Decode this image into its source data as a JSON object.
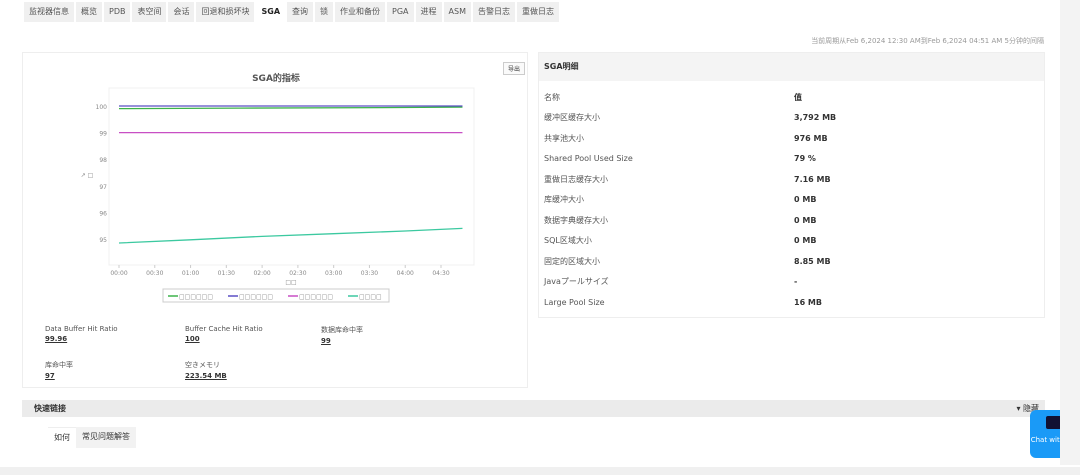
{
  "tabs": [
    "监视器信息",
    "概览",
    "PDB",
    "表空间",
    "会话",
    "回退和损坏块",
    "SGA",
    "查询",
    "锁",
    "作业和备份",
    "PGA",
    "进程",
    "ASM",
    "告警日志",
    "重做日志"
  ],
  "active_tab": "SGA",
  "period_text": "当前周期从Feb 6,2024 12:30 AM到Feb 6,2024 04:51 AM  5分钟的间隔",
  "chart_panel": {
    "export_label": "导出"
  },
  "chart_data": {
    "type": "line",
    "title": "SGA的指标",
    "xlabel": "□□",
    "ylabel": "↗ □",
    "ylim": [
      94.5,
      101
    ],
    "yticks": [
      "100",
      "99",
      "98",
      "97",
      "96",
      "95"
    ],
    "xticks": [
      "00:00",
      "00:30",
      "01:00",
      "01:30",
      "02:00",
      "02:30",
      "03:00",
      "03:30",
      "04:00",
      "04:30"
    ],
    "legend_position": "bottom",
    "series": [
      {
        "name": "□□□□□□",
        "color": "#3cb34a",
        "x": [
          "00:00",
          "01:40",
          "03:40",
          "04:48"
        ],
        "y": [
          99.9,
          99.92,
          99.94,
          99.96
        ]
      },
      {
        "name": "□□□□□□",
        "color": "#5a4fc4",
        "x": [
          "00:00",
          "04:48"
        ],
        "y": [
          100,
          100
        ]
      },
      {
        "name": "□□□□□□",
        "color": "#c84fc4",
        "x": [
          "00:00",
          "04:48"
        ],
        "y": [
          99,
          99
        ]
      },
      {
        "name": "□□□□",
        "color": "#3cc9a0",
        "x": [
          "00:00",
          "01:00",
          "02:00",
          "03:00",
          "04:00",
          "04:48"
        ],
        "y": [
          94.85,
          94.97,
          95.1,
          95.2,
          95.3,
          95.4
        ]
      }
    ]
  },
  "metrics": [
    {
      "label": "Data Buffer Hit Ratio",
      "value": "99.96"
    },
    {
      "label": "Buffer Cache Hit Ratio",
      "value": "100"
    },
    {
      "label": "数据库命中率",
      "value": "99"
    },
    {
      "label": "库命中率",
      "value": "97"
    },
    {
      "label": "空きメモリ",
      "value": "223.54 MB"
    }
  ],
  "details": {
    "title": "SGA明细",
    "header": {
      "name": "名称",
      "value": "值"
    },
    "rows": [
      {
        "name": "缓冲区缓存大小",
        "value": "3,792 MB"
      },
      {
        "name": "共享池大小",
        "value": "976 MB"
      },
      {
        "name": "Shared Pool Used Size",
        "value": "79 %"
      },
      {
        "name": "重做日志缓存大小",
        "value": "7.16 MB"
      },
      {
        "name": "库缓冲大小",
        "value": "0 MB"
      },
      {
        "name": "数据字典缓存大小",
        "value": "0 MB"
      },
      {
        "name": "SQL区域大小",
        "value": "0 MB"
      },
      {
        "name": "固定的区域大小",
        "value": "8.85 MB"
      },
      {
        "name": "Javaプールサイズ",
        "value": "-"
      },
      {
        "name": "Large Pool Size",
        "value": "16 MB"
      }
    ]
  },
  "quick_links": {
    "title": "快速链接",
    "hide_label": "▾ 隐藏",
    "tabs": [
      "如何",
      "常见问题解答"
    ]
  },
  "chat": {
    "label": "Chat with us!",
    "color": "#1a9af7"
  }
}
